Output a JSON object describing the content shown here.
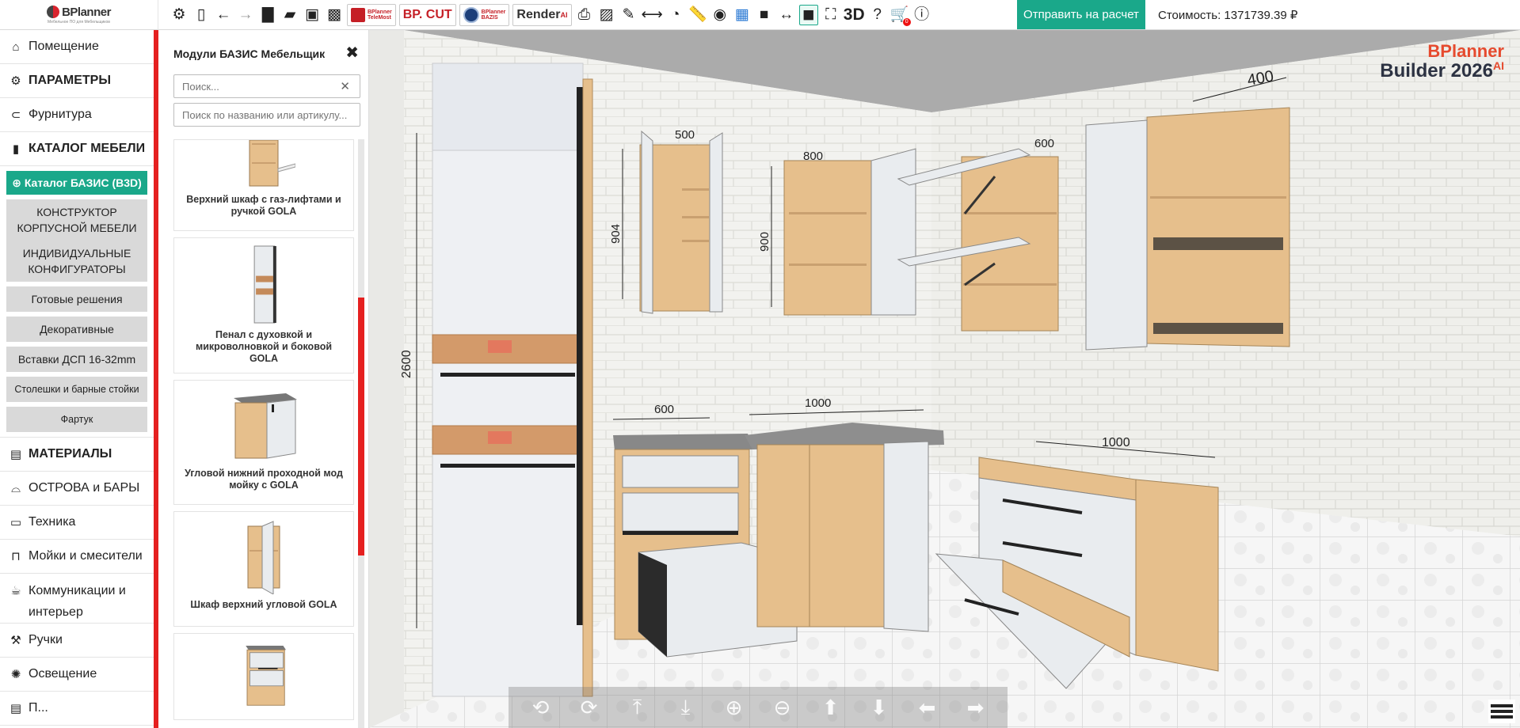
{
  "logo": {
    "text": "BPlanner",
    "sub": "Мебельное ПО для Мебельщиков"
  },
  "toolbar": {
    "brands": {
      "telemost": [
        "BPlanner",
        "TeleMost"
      ],
      "bpcut": "BP. CUT",
      "bazis": [
        "BPlanner",
        "BAZIS"
      ],
      "render": "Render",
      "render_sup": "AI"
    },
    "label_3d": "3D",
    "cart_count": "0"
  },
  "send_button": "Отправить на расчет",
  "cost": "Стоимость: 1371739.39 ₽",
  "sidebar": {
    "items": [
      {
        "label": "Помещение",
        "icon": "⌂"
      },
      {
        "label": "ПАРАМЕТРЫ",
        "icon": "⚙"
      },
      {
        "label": "Фурнитура",
        "icon": "⊂"
      },
      {
        "label": "КАТАЛОГ МЕБЕЛИ",
        "icon": "▮"
      }
    ],
    "catalog_active": "⊕ Каталог БАЗИС (B3D)",
    "catalog_sub": [
      "КОНСТРУКТОР КОРПУСНОЙ МЕБЕЛИ",
      "ИНДИВИДУАЛЬНЫЕ КОНФИГУРАТОРЫ",
      "Готовые решения",
      "Декоративные",
      "Вставки ДСП 16-32mm",
      "Столешки и барные стойки",
      "Фартук"
    ],
    "items2": [
      {
        "label": "МАТЕРИАЛЫ",
        "icon": "▤"
      },
      {
        "label": "ОСТРОВА и БАРЫ",
        "icon": "⌓"
      },
      {
        "label": "Техника",
        "icon": "▭"
      },
      {
        "label": "Мойки и смесители",
        "icon": "⊓"
      },
      {
        "label": "Коммуникации и интерьер",
        "icon": "☕"
      },
      {
        "label": "Ручки",
        "icon": "⚒"
      },
      {
        "label": "Освещение",
        "icon": "✺"
      },
      {
        "label": "П...",
        "icon": "▤"
      }
    ]
  },
  "panel": {
    "title": "Модули БАЗИС Мебельщик",
    "search_placeholder": "Поиск...",
    "search2_placeholder": "Поиск по названию или артикулу...",
    "cards": [
      "Верхний шкаф с газ-лифтами и ручкой GOLA",
      "Пенал с духовкой и микроволновкой и боковой GOLA",
      "Угловой нижний проходной мод мойку с GOLA",
      "Шкаф верхний угловой GOLA",
      ""
    ]
  },
  "scene": {
    "dims": [
      "2600",
      "500",
      "904",
      "800",
      "900",
      "600",
      "400",
      "600",
      "1000",
      "1000"
    ],
    "watermark_top": "BPlanner",
    "watermark_bottom": "Builder 2026",
    "watermark_sup": "AI"
  },
  "nav_icons": [
    "rotate-left-icon",
    "rotate-right-icon",
    "rotate-up-icon",
    "rotate-down-icon",
    "zoom-in-icon",
    "zoom-out-icon",
    "arrow-up-icon",
    "arrow-down-icon",
    "arrow-left-icon",
    "arrow-right-icon"
  ],
  "colors": {
    "accent": "#1aa88a",
    "brand_red": "#e52020",
    "wood": "#e6bf8c",
    "white_panel": "#e9ecef"
  }
}
